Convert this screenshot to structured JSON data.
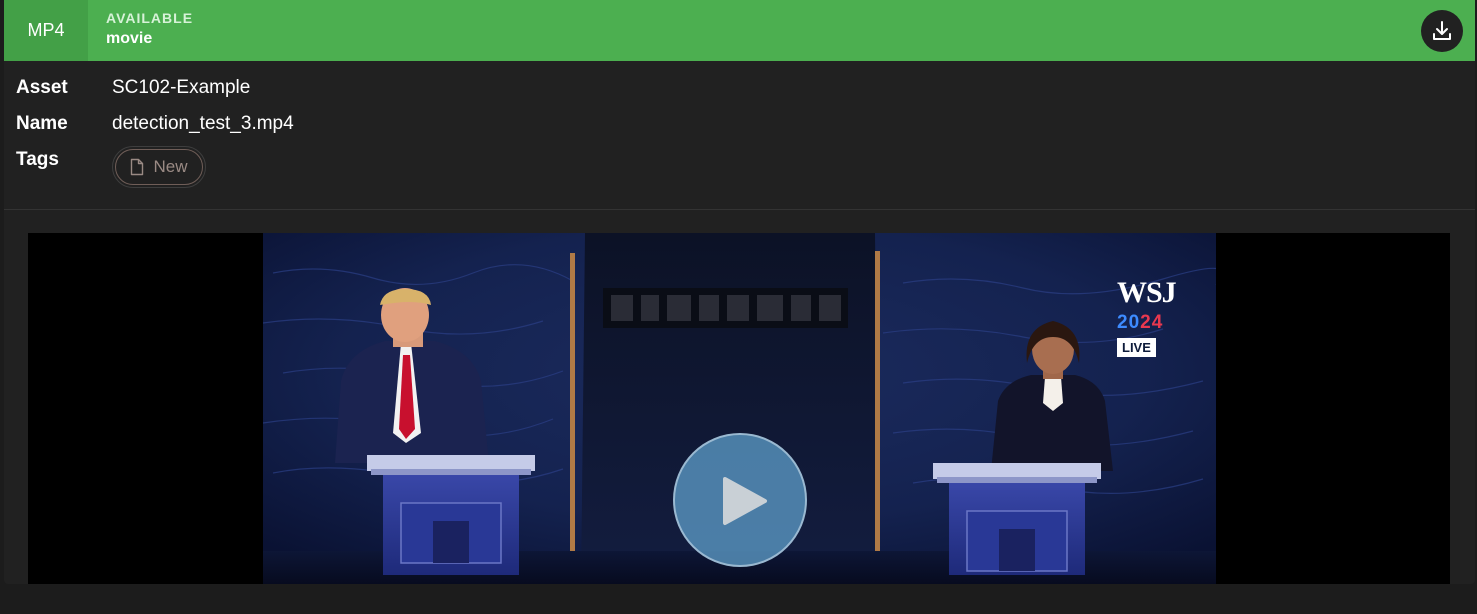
{
  "header": {
    "format_badge": "MP4",
    "status": "AVAILABLE",
    "type": "movie",
    "download_icon": "download-icon"
  },
  "meta": {
    "asset_label": "Asset",
    "asset_value": "SC102-Example",
    "name_label": "Name",
    "name_value": "detection_test_3.mp4",
    "tags_label": "Tags",
    "tags": [
      {
        "label": "New",
        "icon": "file-icon"
      }
    ]
  },
  "video": {
    "play_icon": "play-icon",
    "overlay": {
      "brand": "WSJ",
      "year_a": "2",
      "year_b": "0",
      "year_c": "24",
      "live": "LIVE"
    }
  },
  "colors": {
    "header_bg": "#4caf50",
    "badge_bg": "#43a047",
    "card_bg": "#212121",
    "play_button": "#5894be"
  }
}
